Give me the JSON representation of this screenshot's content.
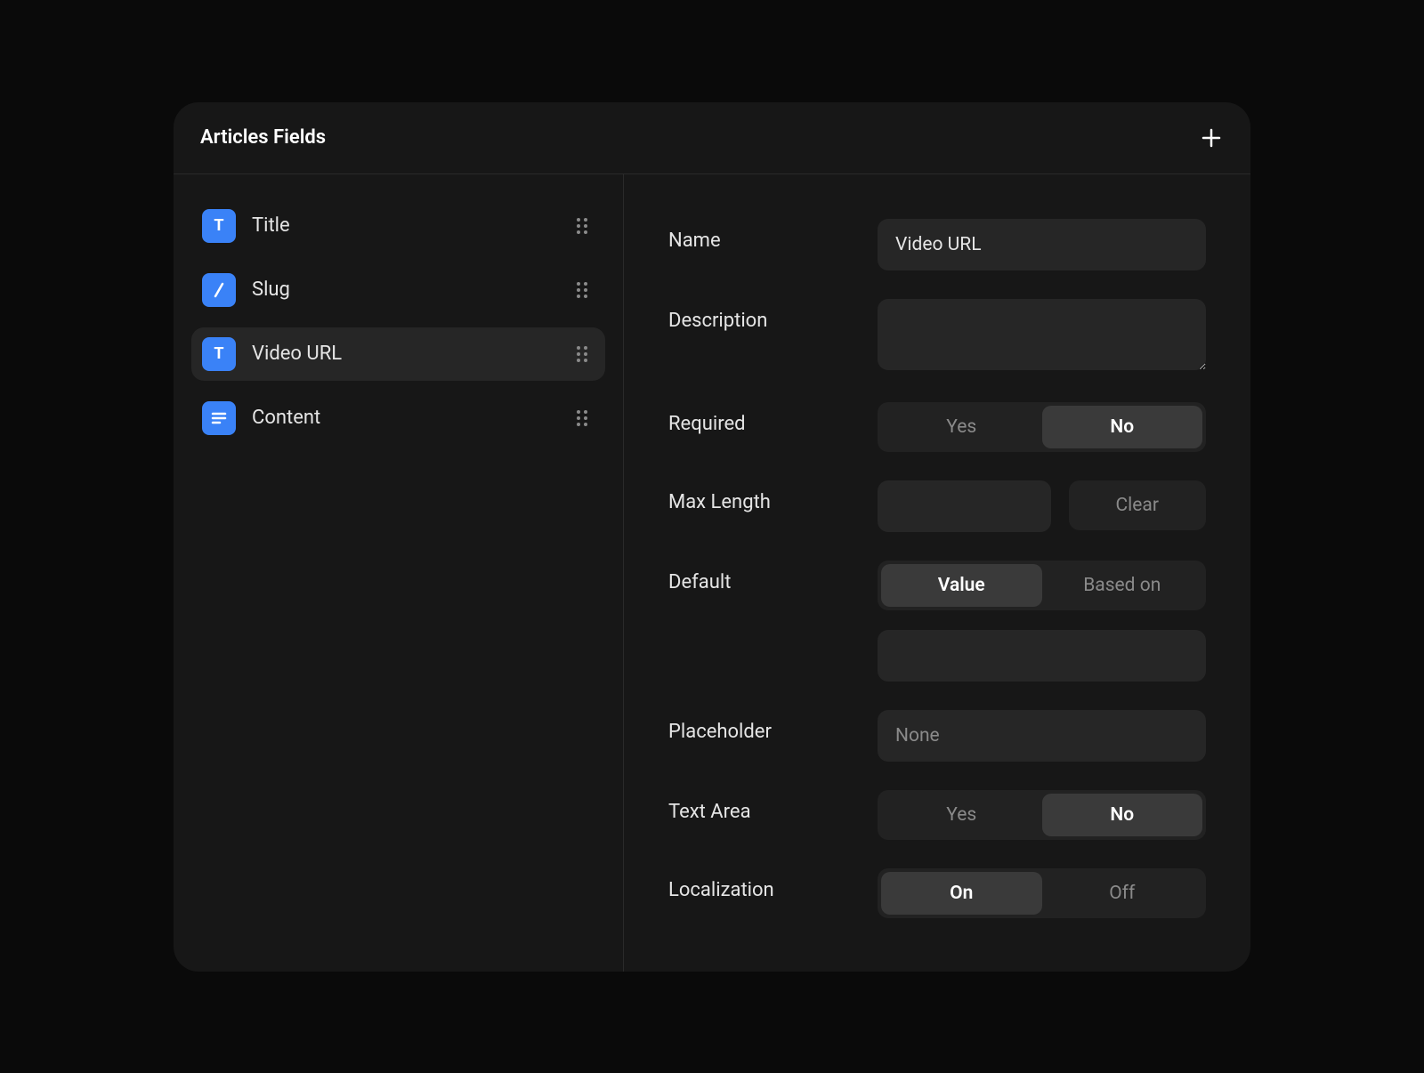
{
  "header": {
    "title": "Articles Fields"
  },
  "fields": [
    {
      "label": "Title",
      "iconType": "T",
      "active": false
    },
    {
      "label": "Slug",
      "iconType": "slash",
      "active": false
    },
    {
      "label": "Video URL",
      "iconType": "T",
      "active": true
    },
    {
      "label": "Content",
      "iconType": "lines",
      "active": false
    }
  ],
  "form": {
    "name": {
      "label": "Name",
      "value": "Video URL"
    },
    "description": {
      "label": "Description",
      "value": ""
    },
    "required": {
      "label": "Required",
      "options": [
        "Yes",
        "No"
      ],
      "selected": "No"
    },
    "maxLength": {
      "label": "Max Length",
      "value": "",
      "clearLabel": "Clear"
    },
    "default": {
      "label": "Default",
      "options": [
        "Value",
        "Based on"
      ],
      "selected": "Value",
      "value": ""
    },
    "placeholder": {
      "label": "Placeholder",
      "placeholderText": "None",
      "value": ""
    },
    "textArea": {
      "label": "Text Area",
      "options": [
        "Yes",
        "No"
      ],
      "selected": "No"
    },
    "localization": {
      "label": "Localization",
      "options": [
        "On",
        "Off"
      ],
      "selected": "On"
    }
  }
}
